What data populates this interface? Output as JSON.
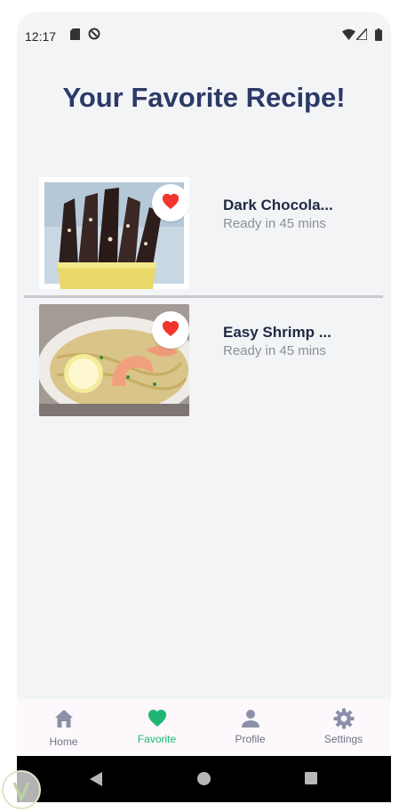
{
  "status_bar": {
    "time": "12:17"
  },
  "page": {
    "title": "Your Favorite Recipe!"
  },
  "recipes": [
    {
      "title": "Dark Chocola...",
      "subtitle": "Ready in 45 mins",
      "favorite": true
    },
    {
      "title": "Easy Shrimp ...",
      "subtitle": "Ready in 45 mins",
      "favorite": true
    }
  ],
  "bottom_nav": {
    "items": [
      {
        "label": "Home",
        "icon": "home-icon",
        "active": false
      },
      {
        "label": "Favorite",
        "icon": "heart-icon",
        "active": true
      },
      {
        "label": "Profile",
        "icon": "person-icon",
        "active": false
      },
      {
        "label": "Settings",
        "icon": "gear-icon",
        "active": false
      }
    ]
  },
  "colors": {
    "title": "#2b3a67",
    "heart": "#f2352c",
    "nav_active": "#1fb673",
    "nav_inactive": "#8a90a8",
    "background": "#f3f4f6"
  }
}
